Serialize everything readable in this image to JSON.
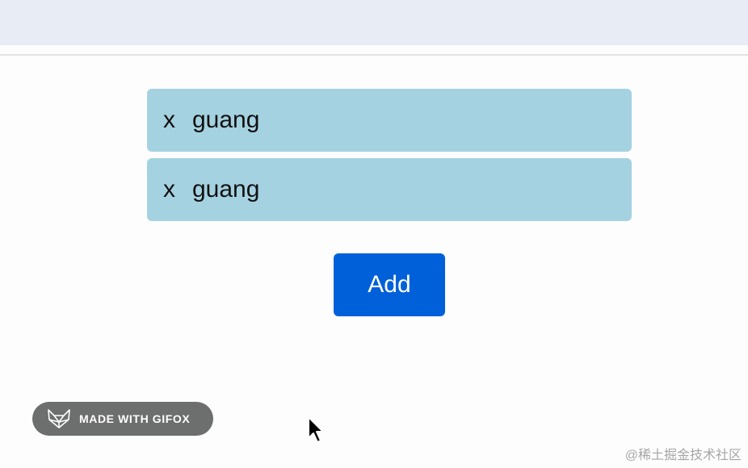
{
  "list": {
    "items": [
      {
        "remove_label": "x",
        "text": "guang"
      },
      {
        "remove_label": "x",
        "text": "guang"
      }
    ]
  },
  "add_button": {
    "label": "Add"
  },
  "badge": {
    "label": "MADE WITH GIFOX"
  },
  "watermark": {
    "text": "@稀土掘金技术社区"
  },
  "colors": {
    "item_bg": "#a5d2e0",
    "button_bg": "#0060d9",
    "topbar_bg": "#e8ecf5",
    "badge_bg": "#6d6e6e"
  }
}
